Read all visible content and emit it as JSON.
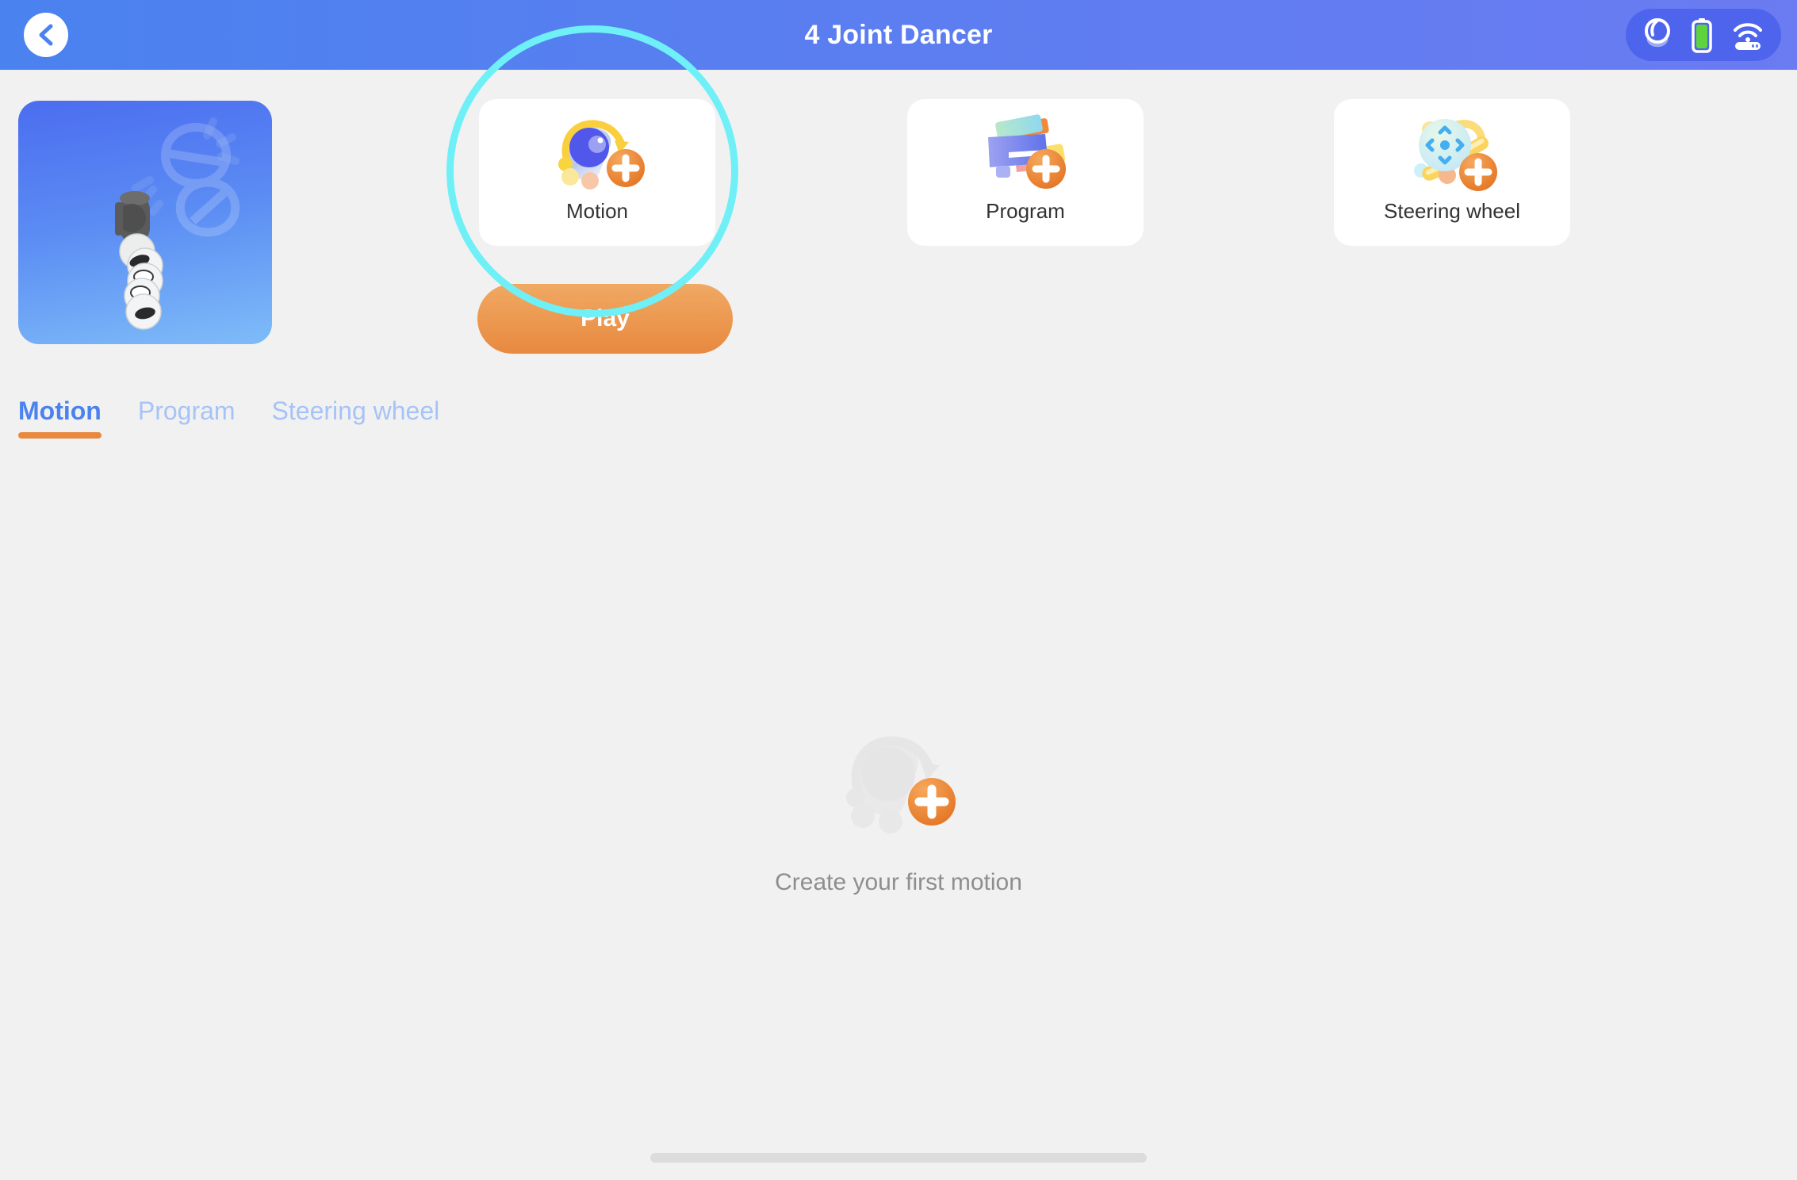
{
  "header": {
    "title": "4 Joint Dancer",
    "back_icon": "chevron-left-icon",
    "status": {
      "device_icon": "robot-device-icon",
      "battery_icon": "battery-full-icon",
      "wifi_icon": "wifi-router-icon",
      "battery_color": "#5ed33c",
      "icon_color": "#ffffff"
    },
    "gradient_from": "#4a82ef",
    "gradient_to": "#6b7bf2"
  },
  "thumbnail": {
    "name": "robot-arm-thumbnail",
    "gradient_from": "#4b6df0",
    "gradient_to": "#7ebcf8"
  },
  "action_cards": [
    {
      "id": "motion",
      "label": "Motion",
      "icon": "motion-add-icon"
    },
    {
      "id": "program",
      "label": "Program",
      "icon": "program-add-icon"
    },
    {
      "id": "steering",
      "label": "Steering wheel",
      "icon": "steering-wheel-add-icon"
    }
  ],
  "play_button": {
    "label": "Play",
    "color_from": "#f0a963",
    "color_to": "#e8893f"
  },
  "highlight": {
    "name": "highlight-ring",
    "color": "#6ff0f7",
    "target": "motion"
  },
  "tabs": [
    {
      "label": "Motion",
      "active": true
    },
    {
      "label": "Program",
      "active": false
    },
    {
      "label": "Steering wheel",
      "active": false
    }
  ],
  "tab_colors": {
    "active_text": "#4a82ef",
    "inactive_text": "#a6c3f7",
    "underline": "#e8893f"
  },
  "empty_state": {
    "icon": "motion-add-placeholder-icon",
    "text": "Create your first motion"
  },
  "home_indicator": {
    "name": "home-indicator"
  },
  "accent_colors": {
    "orange": "#e8893f",
    "blue": "#4a82ef",
    "cyan": "#6ff0f7"
  }
}
